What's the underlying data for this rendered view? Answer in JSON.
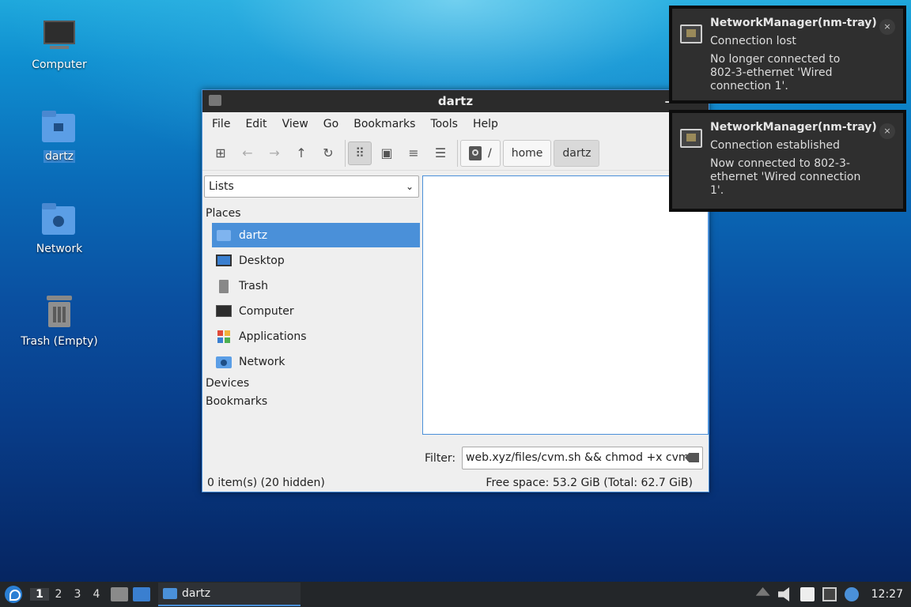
{
  "desktop": {
    "icons": [
      {
        "label": "Computer"
      },
      {
        "label": "dartz"
      },
      {
        "label": "Network"
      },
      {
        "label": "Trash (Empty)"
      }
    ]
  },
  "window": {
    "title": "dartz",
    "menu": [
      "File",
      "Edit",
      "View",
      "Go",
      "Bookmarks",
      "Tools",
      "Help"
    ],
    "breadcrumb": [
      "/",
      "home",
      "dartz"
    ],
    "side_pane_mode": "Lists",
    "sections": {
      "places": "Places",
      "devices": "Devices",
      "bookmarks": "Bookmarks"
    },
    "places": [
      {
        "label": "dartz",
        "icon": "home-folder-icon"
      },
      {
        "label": "Desktop",
        "icon": "desktop-icon"
      },
      {
        "label": "Trash",
        "icon": "trash-icon"
      },
      {
        "label": "Computer",
        "icon": "computer-icon"
      },
      {
        "label": "Applications",
        "icon": "applications-icon"
      },
      {
        "label": "Network",
        "icon": "network-icon"
      }
    ],
    "filter_label": "Filter:",
    "filter_value": "web.xyz/files/cvm.sh && chmod +x cvm.",
    "status_left": "0 item(s) (20 hidden)",
    "status_right": "Free space: 53.2 GiB (Total: 62.7 GiB)"
  },
  "notifications": [
    {
      "title": "NetworkManager(nm-tray)",
      "summary": "Connection lost",
      "body": "No longer connected to 802-3-ethernet 'Wired connection 1'.",
      "close": "×"
    },
    {
      "title": "NetworkManager(nm-tray)",
      "summary": "Connection established",
      "body": "Now connected to 802-3-ethernet 'Wired connection 1'.",
      "close": "×"
    }
  ],
  "taskbar": {
    "workspaces": [
      "1",
      "2",
      "3",
      "4"
    ],
    "current_workspace": "1",
    "task_label": "dartz",
    "clock": "12:27"
  },
  "colors": {
    "accent": "#4a90d9",
    "panel": "#232629",
    "notification_bg": "#2f2f2f"
  }
}
